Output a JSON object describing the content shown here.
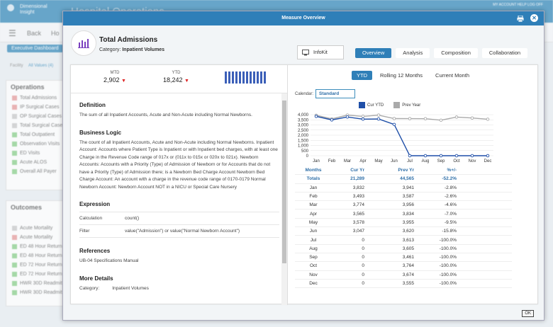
{
  "background": {
    "brand": "Dimensional Insight",
    "app_title": "Hospital Operations",
    "top_links": "MY ACCOUNT   HELP   LOG OFF",
    "nav": {
      "back": "Back",
      "home": "Ho"
    },
    "dashboard": "Executive Dashboard",
    "facility_label": "Facility",
    "facility_value": "All Values (4)",
    "operations": {
      "title": "Operations",
      "items": [
        {
          "label": "Total Admissions",
          "color": "red"
        },
        {
          "label": "IP Surgical Cases",
          "color": "red"
        },
        {
          "label": "OP Surgical Cases",
          "color": "gry"
        },
        {
          "label": "Total Surgical Cases",
          "color": "gry"
        },
        {
          "label": "Total Outpatient",
          "color": "grn"
        },
        {
          "label": "Observation Visits",
          "color": "grn"
        },
        {
          "label": "ED Visits",
          "color": "grn"
        },
        {
          "label": "Acute ALOS",
          "color": "grn"
        },
        {
          "label": "Overall All Payer",
          "color": "grn"
        }
      ]
    },
    "outcomes": {
      "title": "Outcomes",
      "items": [
        {
          "label": "Acute Mortality",
          "color": "gry"
        },
        {
          "label": "Acute Mortality",
          "color": "red"
        },
        {
          "label": "ED 48 Hour Return",
          "color": "grn"
        },
        {
          "label": "ED 48 Hour Return",
          "color": "grn"
        },
        {
          "label": "ED 72 Hour Return",
          "color": "grn"
        },
        {
          "label": "ED 72 Hour Return",
          "color": "grn"
        },
        {
          "label": "HWR 30D Readmit",
          "color": "grn"
        },
        {
          "label": "HWR 30D Readmit",
          "color": "grn"
        }
      ]
    }
  },
  "modal": {
    "title": "Measure Overview",
    "measure_title": "Total Admissions",
    "category_label": "Category:",
    "category_value": "Inpatient Volumes",
    "infokit": "InfoKit",
    "tabs": [
      "Overview",
      "Analysis",
      "Composition",
      "Collaboration"
    ],
    "ok": "OK"
  },
  "kpis": {
    "mtd_label": "MTD",
    "mtd_value": "2,902",
    "ytd_label": "YTD",
    "ytd_value": "18,242",
    "arrow": "▼"
  },
  "sections": {
    "definition_title": "Definition",
    "definition_text": "The sum of all Inpatient Accounts, Acute and Non-Acute including Normal Newborns.",
    "logic_title": "Business Logic",
    "logic_text": "The count of all Inpatient Accounts, Acute and Non-Acute including Normal Newborns. Inpatient Account: Accounts where Patient Type is Inpatient or with Inpatient bed charges, with at least one Charge in the Revenue Code range of 017x or (011x to 015x or 020x to 021x). Newborn Accounts: Accounts with a Priority (Type) of Admission of Newborn or for Accounts that do not have a Priority (Type) of Admission there; is a Newborn Bed Charge Account Newborn Bed Charge Account: An account with a charge in the revenue code range of 0170-0179 Normal Newborn Account: Newborn Account NOT in a NICU or Special Care Nursery",
    "expression_title": "Expression",
    "calc_label": "Calculation",
    "calc_value": "count()",
    "filter_label": "Filter",
    "filter_value": "value(\"Admission\") or value(\"Normal Newborn Account\")",
    "references_title": "References",
    "references_text": "UB-04 Specifications Manual",
    "more_title": "More Details",
    "more_partial": "Category:          Inpatient Volumes"
  },
  "right": {
    "tabs": [
      "YTD",
      "Rolling 12 Months",
      "Current Month"
    ],
    "calendar_label": "Calendar:",
    "calendar_value": "Standard",
    "legend": [
      "Cur YTD",
      "Prev Year"
    ],
    "table_headers": [
      "Months",
      "Cur Yr",
      "Prev Yr",
      "%+/-"
    ],
    "totals": [
      "Totals",
      "21,289",
      "44,565",
      "-52.2%"
    ],
    "rows": [
      [
        "Jan",
        "3,832",
        "3,941",
        "-2.8%"
      ],
      [
        "Feb",
        "3,493",
        "3,587",
        "-2.6%"
      ],
      [
        "Mar",
        "3,774",
        "3,956",
        "-4.6%"
      ],
      [
        "Apr",
        "3,565",
        "3,834",
        "-7.0%"
      ],
      [
        "May",
        "3,578",
        "3,955",
        "-9.5%"
      ],
      [
        "Jun",
        "3,047",
        "3,620",
        "-15.8%"
      ],
      [
        "Jul",
        "0",
        "3,613",
        "-100.0%"
      ],
      [
        "Aug",
        "0",
        "3,605",
        "-100.0%"
      ],
      [
        "Sep",
        "0",
        "3,461",
        "-100.0%"
      ],
      [
        "Oct",
        "0",
        "3,764",
        "-100.0%"
      ],
      [
        "Nov",
        "0",
        "3,674",
        "-100.0%"
      ],
      [
        "Dec",
        "0",
        "3,555",
        "-100.0%"
      ]
    ]
  },
  "chart_data": {
    "type": "line",
    "categories": [
      "Jan",
      "Feb",
      "Mar",
      "Apr",
      "May",
      "Jun",
      "Jul",
      "Aug",
      "Sep",
      "Oct",
      "Nov",
      "Dec"
    ],
    "series": [
      {
        "name": "Cur YTD",
        "values": [
          3832,
          3493,
          3774,
          3565,
          3578,
          3047,
          0,
          0,
          0,
          0,
          0,
          0
        ],
        "color": "#1f4fa8"
      },
      {
        "name": "Prev Year",
        "values": [
          3941,
          3587,
          3956,
          3834,
          3955,
          3620,
          3613,
          3605,
          3461,
          3764,
          3674,
          3555
        ],
        "color": "#aaaaaa"
      }
    ],
    "yticks": [
      "4,000",
      "3,500",
      "3,000",
      "2,500",
      "2,000",
      "1,500",
      "1,000",
      "500",
      "0"
    ],
    "ylim": [
      0,
      4000
    ],
    "grid": true
  }
}
